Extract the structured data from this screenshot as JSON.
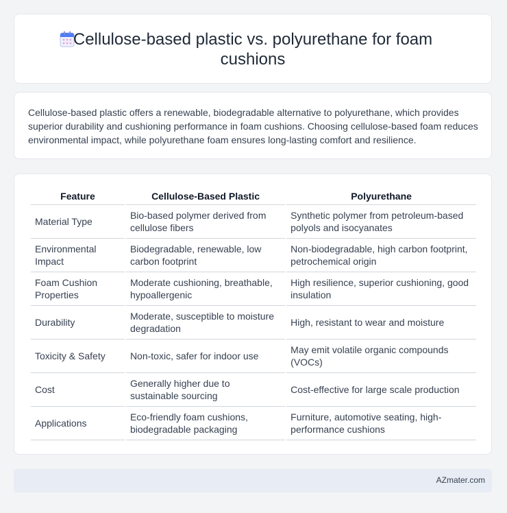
{
  "header": {
    "title": "Cellulose-based plastic vs. polyurethane for foam cushions",
    "icon": "calendar-icon"
  },
  "summary": {
    "text": "Cellulose-based plastic offers a renewable, biodegradable alternative to polyurethane, which provides superior durability and cushioning performance in foam cushions. Choosing cellulose-based foam reduces environmental impact, while polyurethane foam ensures long-lasting comfort and resilience."
  },
  "table": {
    "headers": [
      "Feature",
      "Cellulose-Based Plastic",
      "Polyurethane"
    ],
    "rows": [
      [
        "Material Type",
        "Bio-based polymer derived from cellulose fibers",
        "Synthetic polymer from petroleum-based polyols and isocyanates"
      ],
      [
        "Environmental Impact",
        "Biodegradable, renewable, low carbon footprint",
        "Non-biodegradable, high carbon footprint, petrochemical origin"
      ],
      [
        "Foam Cushion Properties",
        "Moderate cushioning, breathable, hypoallergenic",
        "High resilience, superior cushioning, good insulation"
      ],
      [
        "Durability",
        "Moderate, susceptible to moisture degradation",
        "High, resistant to wear and moisture"
      ],
      [
        "Toxicity & Safety",
        "Non-toxic, safer for indoor use",
        "May emit volatile organic compounds (VOCs)"
      ],
      [
        "Cost",
        "Generally higher due to sustainable sourcing",
        "Cost-effective for large scale production"
      ],
      [
        "Applications",
        "Eco-friendly foam cushions, biodegradable packaging",
        "Furniture, automotive seating, high-performance cushions"
      ]
    ]
  },
  "footer": {
    "text": "AZmater.com"
  },
  "colors": {
    "background": "#f3f4f6",
    "card": "#ffffff",
    "footer_bg": "#e8edf5",
    "icon_blue": "#4f7cf6",
    "icon_pink": "#e9a3d6"
  }
}
